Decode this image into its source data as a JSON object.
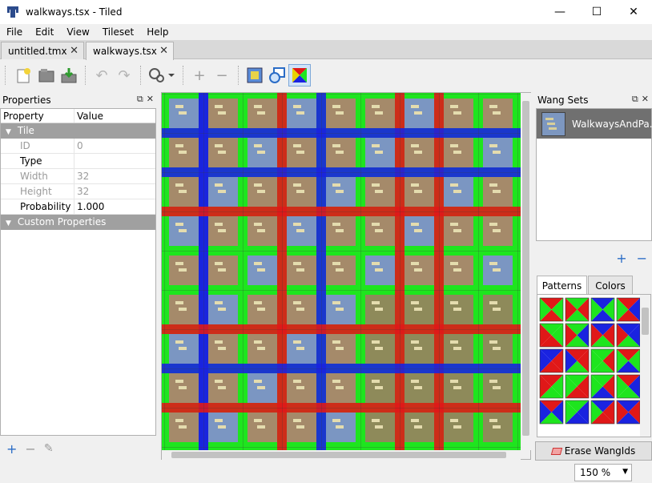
{
  "window": {
    "title": "walkways.tsx - Tiled",
    "minimize": "—",
    "maximize": "☐",
    "close": "✕"
  },
  "menu": [
    "File",
    "Edit",
    "View",
    "Tileset",
    "Help"
  ],
  "menu_mnemonics": [
    "F",
    "E",
    "V",
    "",
    "H"
  ],
  "tabs": [
    {
      "label": "untitled.tmx",
      "active": false
    },
    {
      "label": "walkways.tsx",
      "active": true
    }
  ],
  "toolbar": {
    "icons": [
      "new-tileset-icon",
      "open-icon",
      "save-icon",
      "undo-icon",
      "redo-icon",
      "tileset-properties-icon",
      "add-tiles-icon",
      "remove-tiles-icon",
      "edit-terrain-icon",
      "edit-collision-icon",
      "edit-wang-sets-icon"
    ]
  },
  "properties_panel": {
    "title": "Properties",
    "columns": [
      "Property",
      "Value"
    ],
    "group_tile": "Tile",
    "rows": [
      {
        "key": "ID",
        "value": "0",
        "dim": true
      },
      {
        "key": "Type",
        "value": "",
        "dim": false
      },
      {
        "key": "Width",
        "value": "32",
        "dim": true
      },
      {
        "key": "Height",
        "value": "32",
        "dim": true
      },
      {
        "key": "Probability",
        "value": "1.000",
        "dim": false
      }
    ],
    "group_custom": "Custom Properties",
    "add_label": "+",
    "remove_label": "−",
    "edit_label": "✎"
  },
  "wang_sets": {
    "title": "Wang Sets",
    "item": "WalkwaysAndPa...",
    "add_label": "+",
    "remove_label": "−"
  },
  "wang_tabs": [
    "Patterns",
    "Colors"
  ],
  "erase_button": "Erase WangIds",
  "zoom": "150 %",
  "colors": {
    "green": "#1ee51e",
    "red": "#e01818",
    "blue": "#1a23e0",
    "selected_bg": "#707070",
    "accent": "#2a6cc6"
  }
}
